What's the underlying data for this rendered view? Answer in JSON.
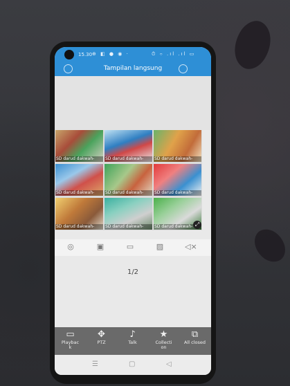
{
  "status_bar": {
    "time": "15.30",
    "left_icons": "⊕ ◧ ● ◉ ·",
    "right_icons": "⏱ ⌔ .ıl .ıl ▭"
  },
  "header": {
    "title": "Tampilan langsung",
    "menu_icon": "list-icon",
    "settings_icon": "gear-icon"
  },
  "cameras": [
    {
      "label": "SD darud dakwah-",
      "scene": "classroom-orange"
    },
    {
      "label": "SD darud dakwah-",
      "scene": "classroom-blue"
    },
    {
      "label": "SD darud dakwah-",
      "scene": "hallway-orange"
    },
    {
      "label": "SD darud dakwah-",
      "scene": "classroom-blue-red"
    },
    {
      "label": "SD darud dakwah-",
      "scene": "playground"
    },
    {
      "label": "SD darud dakwah-",
      "scene": "room-red"
    },
    {
      "label": "SD darud dakwah-",
      "scene": "classroom-yellow"
    },
    {
      "label": "SD darud dakwah-",
      "scene": "yard-green"
    },
    {
      "label": "SD darud dakwah-",
      "scene": "building-green"
    }
  ],
  "toolbar": {
    "icons": [
      "camera-icon",
      "record-icon",
      "screen-icon",
      "quality-icon",
      "mute-icon"
    ]
  },
  "page_indicator": "1/2",
  "bottom_nav": [
    {
      "label": "Playbac\nk",
      "icon": "playback-icon"
    },
    {
      "label": "PTZ",
      "icon": "ptz-icon"
    },
    {
      "label": "Talk",
      "icon": "microphone-icon"
    },
    {
      "label": "Collecti\non",
      "icon": "star-icon"
    },
    {
      "label": "All closed",
      "icon": "close-all-icon"
    }
  ],
  "system_nav": {
    "menu": "☰",
    "home": "▢",
    "back": "◁"
  }
}
